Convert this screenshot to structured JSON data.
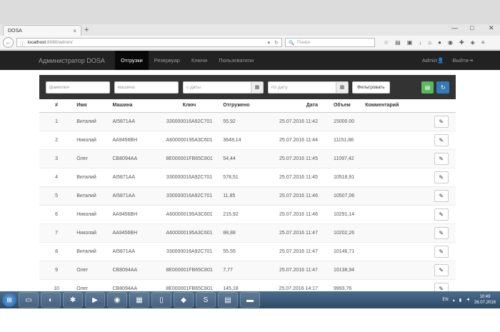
{
  "browser": {
    "tab_title": "DOSA",
    "tab_close": "×",
    "new_tab": "+",
    "window_controls": [
      "—",
      "□",
      "✕"
    ],
    "url_host": "localhost",
    "url_rest": ":8080/admin/",
    "search_placeholder": "Поиск"
  },
  "app": {
    "brand": "Администратор DOSA",
    "nav": [
      {
        "label": "Отгрузки",
        "active": true
      },
      {
        "label": "Резервуар",
        "active": false
      },
      {
        "label": "Ключи",
        "active": false
      },
      {
        "label": "Пользователи",
        "active": false
      }
    ],
    "user": "Admin",
    "logout": "Выйти"
  },
  "filters": {
    "lastname_placeholder": "фамилия",
    "car_placeholder": "машина",
    "from_placeholder": "с даты",
    "to_placeholder": "по дату",
    "filter_button": "Фильтровать"
  },
  "table": {
    "headers": [
      "#",
      "Имя",
      "Машина",
      "Ключ",
      "Отгружено",
      "Дата",
      "Объем",
      "Комментарий"
    ],
    "rows": [
      {
        "num": "1",
        "name": "Виталий",
        "car": "AI5871AA",
        "key": "330000016A92C701",
        "shipped": "55,92",
        "date": "25.07.2016 11:42",
        "volume": "15000.00",
        "comment": ""
      },
      {
        "num": "2",
        "name": "Николай",
        "car": "AA9456BH",
        "key": "A600000195A3C601",
        "shipped": "3648,14",
        "date": "25.07.2016 11:44",
        "volume": "11151,86",
        "comment": ""
      },
      {
        "num": "3",
        "name": "Олег",
        "car": "CB8094AA",
        "key": "8E000001FB65C801",
        "shipped": "54,44",
        "date": "25.07.2016 11:45",
        "volume": "11097,42",
        "comment": ""
      },
      {
        "num": "4",
        "name": "Виталий",
        "car": "AI5871AA",
        "key": "330000016A92C701",
        "shipped": "578,51",
        "date": "25.07.2016 11:45",
        "volume": "10518,91",
        "comment": ""
      },
      {
        "num": "5",
        "name": "Виталий",
        "car": "AI5871AA",
        "key": "330000016A92C701",
        "shipped": "11,85",
        "date": "25.07.2016 11:46",
        "volume": "10507,06",
        "comment": ""
      },
      {
        "num": "6",
        "name": "Николай",
        "car": "AA9456BH",
        "key": "A600000195A3C601",
        "shipped": "215,92",
        "date": "25.07.2016 11:46",
        "volume": "10291,14",
        "comment": ""
      },
      {
        "num": "7",
        "name": "Николай",
        "car": "AA9456BH",
        "key": "A600000195A3C601",
        "shipped": "88,88",
        "date": "25.07.2016 11:47",
        "volume": "10202,26",
        "comment": ""
      },
      {
        "num": "8",
        "name": "Виталий",
        "car": "AI5871AA",
        "key": "330000016A92C701",
        "shipped": "55,55",
        "date": "25.07.2016 11:47",
        "volume": "10146,71",
        "comment": ""
      },
      {
        "num": "9",
        "name": "Олег",
        "car": "CB8094AA",
        "key": "8E000001FB65C801",
        "shipped": "7,77",
        "date": "25.07.2016 11:47",
        "volume": "10138,94",
        "comment": ""
      },
      {
        "num": "10",
        "name": "Олег",
        "car": "CB8094AA",
        "key": "8E000001FB65C801",
        "shipped": "145,18",
        "date": "25.07.2016 14:17",
        "volume": "9993,76",
        "comment": ""
      }
    ]
  },
  "taskbar": {
    "lang": "EN",
    "time": "10:49",
    "date": "26.07.2016"
  },
  "colors": {
    "navbar": "#222222",
    "filterbar": "#333333",
    "green_button": "#5cb85c",
    "blue_button": "#337ab7"
  }
}
